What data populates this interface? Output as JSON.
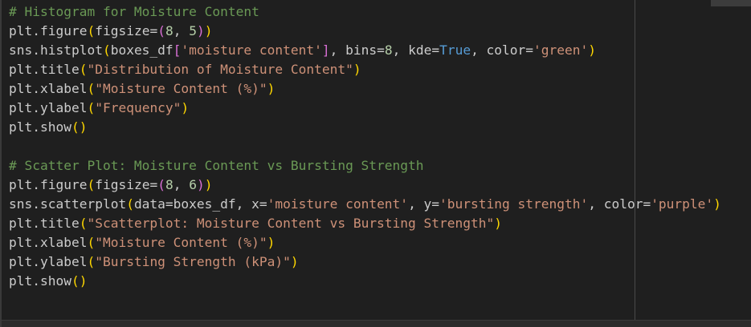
{
  "lines": [
    [
      {
        "t": "comment",
        "v": "# Histogram for Moisture Content"
      }
    ],
    [
      {
        "t": "ident",
        "v": "plt.figure"
      },
      {
        "t": "p1",
        "v": "("
      },
      {
        "t": "ident",
        "v": "figsize="
      },
      {
        "t": "p2",
        "v": "("
      },
      {
        "t": "num",
        "v": "8"
      },
      {
        "t": "ident",
        "v": ", "
      },
      {
        "t": "num",
        "v": "5"
      },
      {
        "t": "p2",
        "v": ")"
      },
      {
        "t": "p1",
        "v": ")"
      }
    ],
    [
      {
        "t": "ident",
        "v": "sns.histplot"
      },
      {
        "t": "p1",
        "v": "("
      },
      {
        "t": "ident",
        "v": "boxes_df"
      },
      {
        "t": "p2",
        "v": "["
      },
      {
        "t": "str",
        "v": "'moisture content'"
      },
      {
        "t": "p2",
        "v": "]"
      },
      {
        "t": "ident",
        "v": ", bins="
      },
      {
        "t": "num",
        "v": "8"
      },
      {
        "t": "ident",
        "v": ", kde="
      },
      {
        "t": "kw",
        "v": "True"
      },
      {
        "t": "ident",
        "v": ", color="
      },
      {
        "t": "str",
        "v": "'green'"
      },
      {
        "t": "p1",
        "v": ")"
      }
    ],
    [
      {
        "t": "ident",
        "v": "plt.title"
      },
      {
        "t": "p1",
        "v": "("
      },
      {
        "t": "str",
        "v": "\"Distribution of Moisture Content\""
      },
      {
        "t": "p1",
        "v": ")"
      }
    ],
    [
      {
        "t": "ident",
        "v": "plt.xlabel"
      },
      {
        "t": "p1",
        "v": "("
      },
      {
        "t": "str",
        "v": "\"Moisture Content (%)\""
      },
      {
        "t": "p1",
        "v": ")"
      }
    ],
    [
      {
        "t": "ident",
        "v": "plt.ylabel"
      },
      {
        "t": "p1",
        "v": "("
      },
      {
        "t": "str",
        "v": "\"Frequency\""
      },
      {
        "t": "p1",
        "v": ")"
      }
    ],
    [
      {
        "t": "ident",
        "v": "plt.show"
      },
      {
        "t": "p1",
        "v": "()"
      }
    ],
    [],
    [
      {
        "t": "comment",
        "v": "# Scatter Plot: Moisture Content vs Bursting Strength"
      }
    ],
    [
      {
        "t": "ident",
        "v": "plt.figure"
      },
      {
        "t": "p1",
        "v": "("
      },
      {
        "t": "ident",
        "v": "figsize="
      },
      {
        "t": "p2",
        "v": "("
      },
      {
        "t": "num",
        "v": "8"
      },
      {
        "t": "ident",
        "v": ", "
      },
      {
        "t": "num",
        "v": "6"
      },
      {
        "t": "p2",
        "v": ")"
      },
      {
        "t": "p1",
        "v": ")"
      }
    ],
    [
      {
        "t": "ident",
        "v": "sns.scatterplot"
      },
      {
        "t": "p1",
        "v": "("
      },
      {
        "t": "ident",
        "v": "data=boxes_df, x="
      },
      {
        "t": "str",
        "v": "'moisture content'"
      },
      {
        "t": "ident",
        "v": ", y="
      },
      {
        "t": "str",
        "v": "'bursting strength'"
      },
      {
        "t": "ident",
        "v": ", color="
      },
      {
        "t": "str",
        "v": "'purple'"
      },
      {
        "t": "p1",
        "v": ")"
      }
    ],
    [
      {
        "t": "ident",
        "v": "plt.title"
      },
      {
        "t": "p1",
        "v": "("
      },
      {
        "t": "str",
        "v": "\"Scatterplot: Moisture Content vs Bursting Strength\""
      },
      {
        "t": "p1",
        "v": ")"
      }
    ],
    [
      {
        "t": "ident",
        "v": "plt.xlabel"
      },
      {
        "t": "p1",
        "v": "("
      },
      {
        "t": "str",
        "v": "\"Moisture Content (%)\""
      },
      {
        "t": "p1",
        "v": ")"
      }
    ],
    [
      {
        "t": "ident",
        "v": "plt.ylabel"
      },
      {
        "t": "p1",
        "v": "("
      },
      {
        "t": "str",
        "v": "\"Bursting Strength (kPa)\""
      },
      {
        "t": "p1",
        "v": ")"
      }
    ],
    [
      {
        "t": "ident",
        "v": "plt.show"
      },
      {
        "t": "p1",
        "v": "()"
      }
    ]
  ],
  "colors": {
    "background": "#1f1f1f",
    "comment": "#6a9955",
    "string": "#ce9178",
    "number": "#b5cea8",
    "keyword": "#569cd6",
    "bracket_level1": "#ffd700",
    "bracket_level2": "#da70d6"
  }
}
